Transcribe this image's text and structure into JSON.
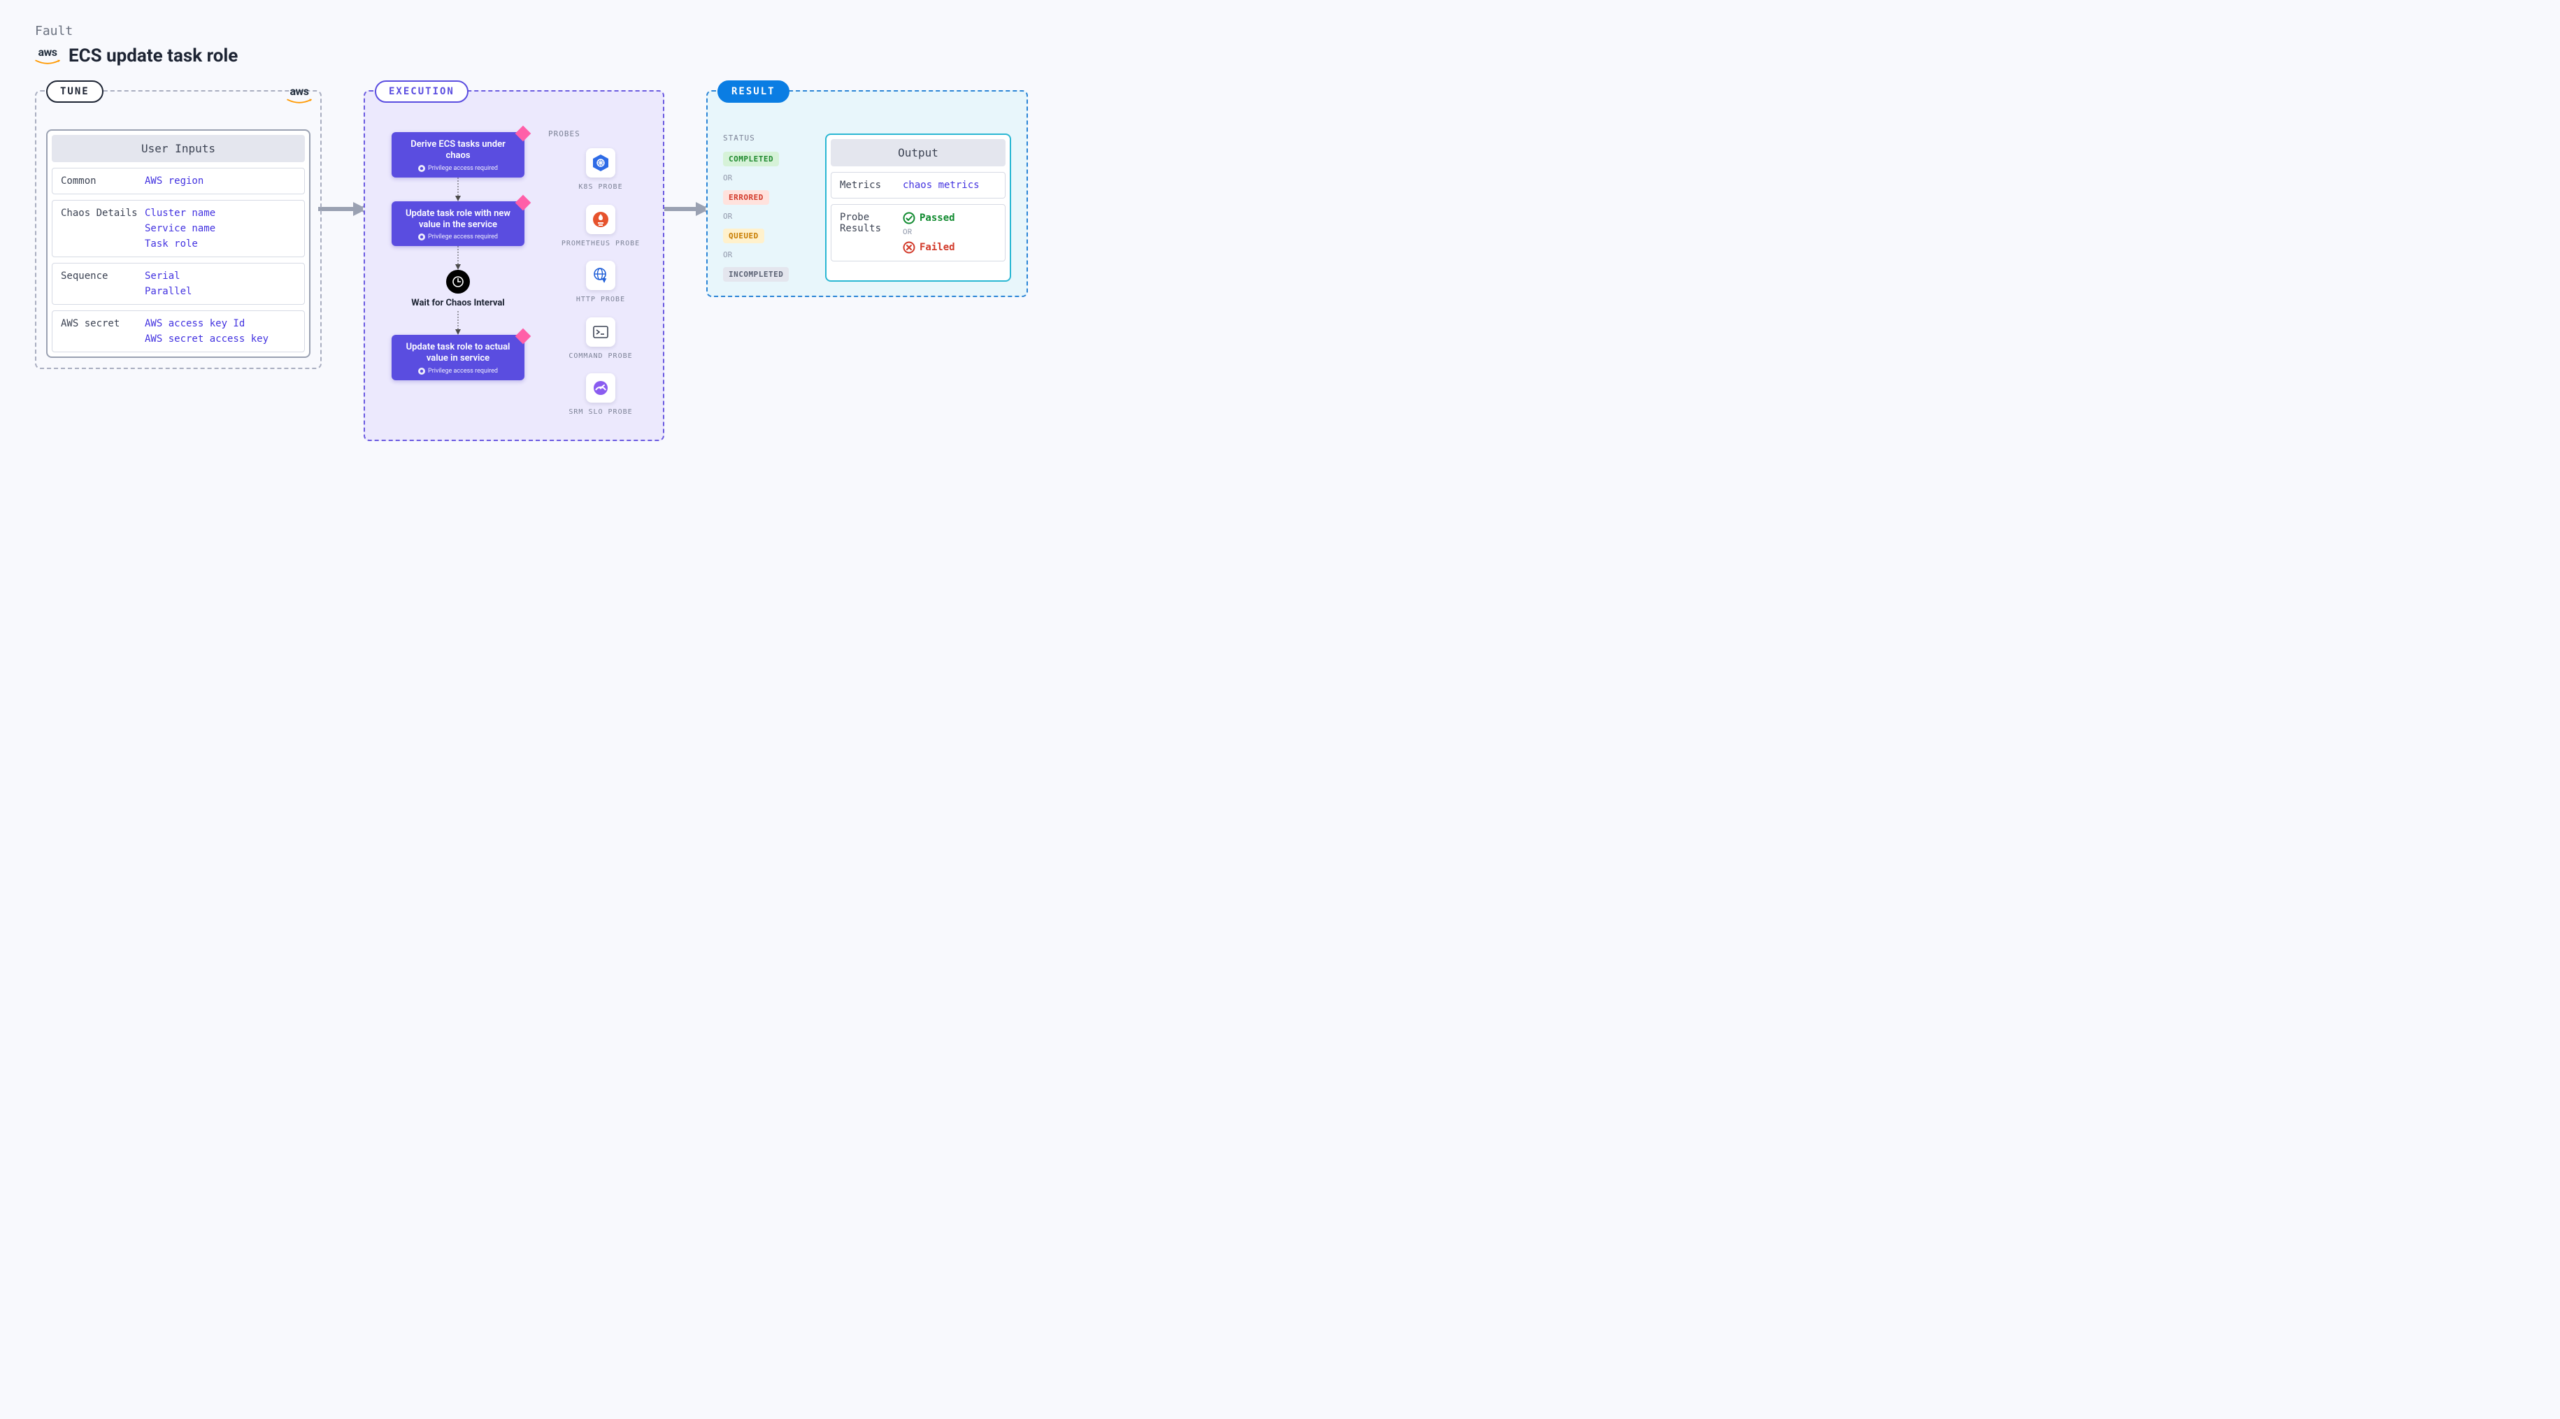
{
  "header": {
    "eyebrow": "Fault",
    "title": "ECS update task role"
  },
  "tune": {
    "pill": "TUNE",
    "inputs_title": "User Inputs",
    "rows": [
      {
        "label": "Common",
        "values": [
          "AWS region"
        ]
      },
      {
        "label": "Chaos Details",
        "values": [
          "Cluster name",
          "Service name",
          "Task role"
        ]
      },
      {
        "label": "Sequence",
        "values": [
          "Serial",
          "Parallel"
        ]
      },
      {
        "label": "AWS secret",
        "values": [
          "AWS access key Id",
          "AWS secret access key"
        ]
      }
    ]
  },
  "execution": {
    "pill": "EXECUTION",
    "privilege_note": "Privilege access required",
    "steps": {
      "step1": "Derive ECS tasks under chaos",
      "step2": "Update task role with new value in the service",
      "wait": "Wait for Chaos Interval",
      "step3": "Update task role to actual value in service"
    },
    "probes_title": "PROBES",
    "probes": {
      "k8s": "K8S PROBE",
      "prometheus": "PROMETHEUS PROBE",
      "http": "HTTP PROBE",
      "command": "COMMAND PROBE",
      "srm": "SRM SLO PROBE"
    }
  },
  "result": {
    "pill": "RESULT",
    "status_title": "STATUS",
    "or": "OR",
    "statuses": {
      "completed": "COMPLETED",
      "errored": "ERRORED",
      "queued": "QUEUED",
      "incompleted": "INCOMPLETED"
    },
    "output_title": "Output",
    "metrics_label": "Metrics",
    "metrics_value": "chaos metrics",
    "probe_results_label": "Probe Results",
    "passed": "Passed",
    "failed": "Failed"
  }
}
